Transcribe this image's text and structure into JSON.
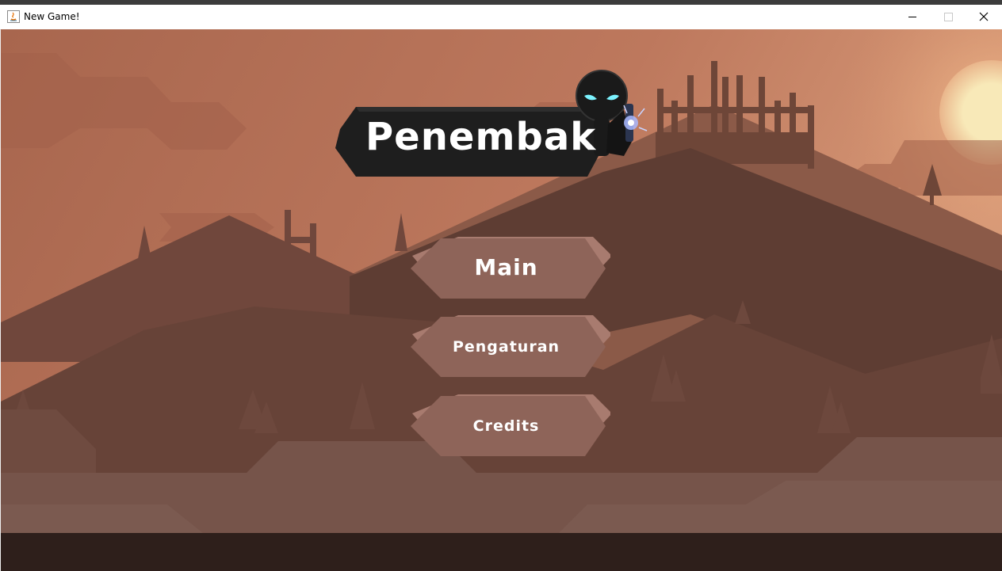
{
  "window": {
    "title": "New Game!",
    "controls": [
      "minimize-icon",
      "maximize-icon",
      "close-icon"
    ]
  },
  "game": {
    "logo": "Penembak",
    "menu": [
      {
        "id": "main",
        "label": "Main"
      },
      {
        "id": "pengaturan",
        "label": "Pengaturan"
      },
      {
        "id": "credits",
        "label": "Credits"
      }
    ]
  },
  "colors": {
    "sky_top": "#b06f55",
    "sky_bottom": "#c9876a",
    "sun": "#f7e6b0",
    "button_fill": "#8e6459",
    "button_shadow": "#a87b6f",
    "ground": "#2e1f1b",
    "logo_banner": "#1e1e1e"
  }
}
